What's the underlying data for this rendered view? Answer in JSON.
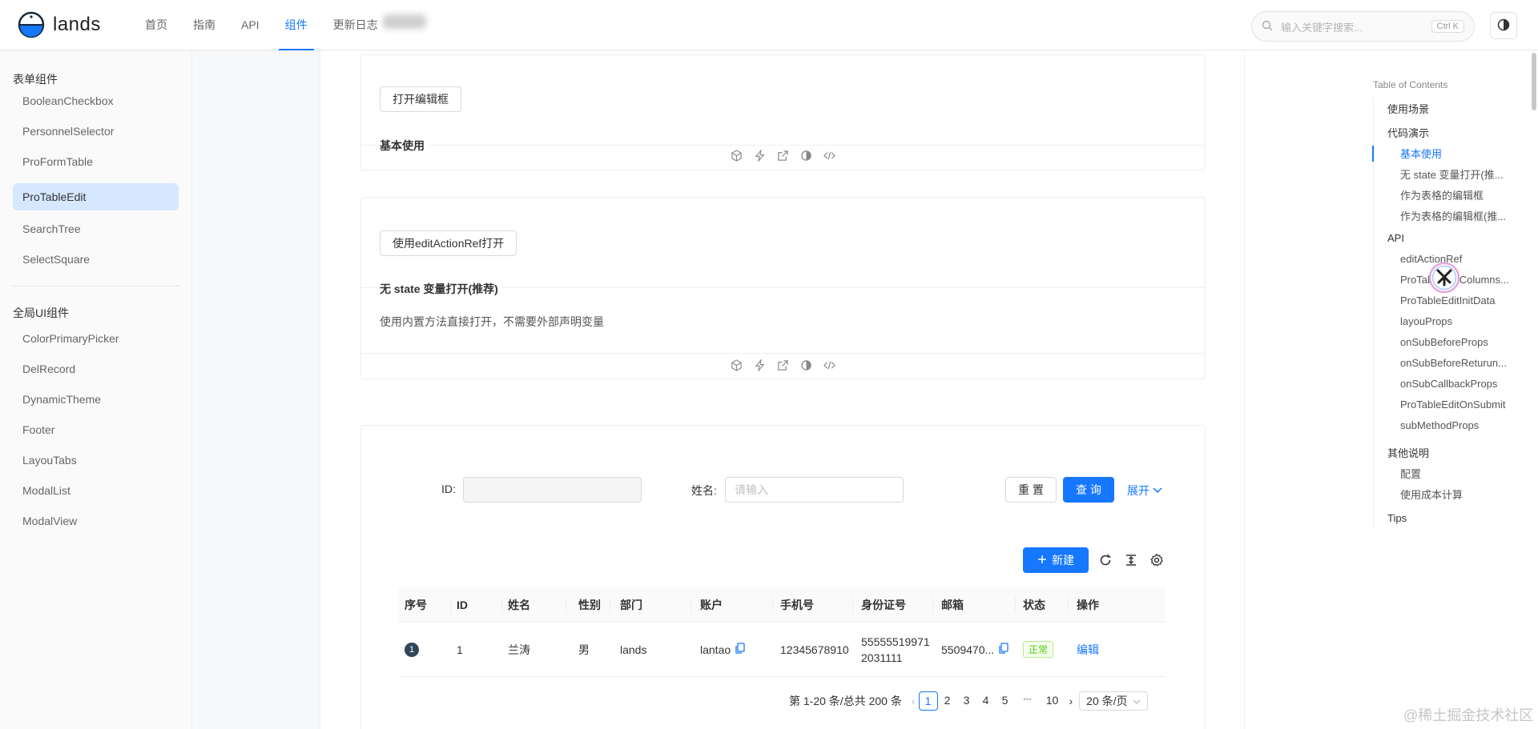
{
  "header": {
    "logo_text": "lands",
    "nav": [
      {
        "label": "首页"
      },
      {
        "label": "指南"
      },
      {
        "label": "API"
      },
      {
        "label": "组件"
      },
      {
        "label": "更新日志"
      }
    ],
    "search_placeholder": "输入关键字搜索...",
    "search_shortcut": "Ctrl K"
  },
  "sidebar": {
    "groups": [
      {
        "title": "表单组件",
        "items": [
          "BooleanCheckbox",
          "PersonnelSelector",
          "ProFormTable",
          "ProTableEdit",
          "SearchTree",
          "SelectSquare"
        ]
      },
      {
        "title": "全局UI组件",
        "items": [
          "ColorPrimaryPicker",
          "DelRecord",
          "DynamicTheme",
          "Footer",
          "LayouTabs",
          "ModalList",
          "ModalView"
        ]
      }
    ],
    "active_item": "ProTableEdit"
  },
  "demo1": {
    "button": "打开编辑框",
    "title": "基本使用"
  },
  "demo2": {
    "button": "使用editActionRef打开",
    "title": "无 state 变量打开(推荐)",
    "desc": "使用内置方法直接打开，不需要外部声明变量"
  },
  "table_demo": {
    "search": {
      "id_label": "ID:",
      "name_label": "姓名:",
      "name_placeholder": "请输入",
      "reset": "重 置",
      "query": "查 询",
      "expand": "展开"
    },
    "toolbar": {
      "new_button": "新建"
    },
    "columns": [
      "序号",
      "ID",
      "姓名",
      "性别",
      "部门",
      "账户",
      "手机号",
      "身份证号",
      "邮箱",
      "状态",
      "操作"
    ],
    "rows": [
      {
        "index": "1",
        "id": "1",
        "name": "兰涛",
        "gender": "男",
        "dept": "lands",
        "account": "lantao",
        "phone": "12345678910",
        "id_card_1": "55555519971",
        "id_card_2": "2031111",
        "email": "5509470...",
        "status": "正常",
        "action": "编辑"
      }
    ],
    "pagination": {
      "summary": "第 1-20 条/总共 200 条",
      "pages": [
        "1",
        "2",
        "3",
        "4",
        "5"
      ],
      "ellipsis": "•••",
      "last": "10",
      "page_size": "20 条/页",
      "current": "1"
    }
  },
  "toc": {
    "title": "Table of Contents",
    "items": [
      {
        "label": "使用场景",
        "level": 1
      },
      {
        "label": "代码演示",
        "level": 1
      },
      {
        "label": "基本使用",
        "level": 2
      },
      {
        "label": "无 state 变量打开(推...",
        "level": 2
      },
      {
        "label": "作为表格的编辑框",
        "level": 2
      },
      {
        "label": "作为表格的编辑框(推...",
        "level": 2
      },
      {
        "label": "API",
        "level": 1
      },
      {
        "label": "editActionRef",
        "level": 2
      },
      {
        "label": "ProTableEditColumns...",
        "level": 2
      },
      {
        "label": "ProTableEditInitData",
        "level": 2
      },
      {
        "label": "layouProps",
        "level": 2
      },
      {
        "label": "onSubBeforeProps",
        "level": 2
      },
      {
        "label": "onSubBeforeReturun...",
        "level": 2
      },
      {
        "label": "onSubCallbackProps",
        "level": 2
      },
      {
        "label": "ProTableEditOnSubmit",
        "level": 2
      },
      {
        "label": "subMethodProps",
        "level": 2
      },
      {
        "label": "其他说明",
        "level": 1
      },
      {
        "label": "配置",
        "level": 2
      },
      {
        "label": "使用成本计算",
        "level": 2
      },
      {
        "label": "Tips",
        "level": 1
      }
    ],
    "active": "基本使用"
  },
  "watermark": "@稀土掘金技术社区",
  "colors": {
    "accent": "#1677ff",
    "active_bg": "#d6e8ff",
    "success": "#52c41a"
  }
}
